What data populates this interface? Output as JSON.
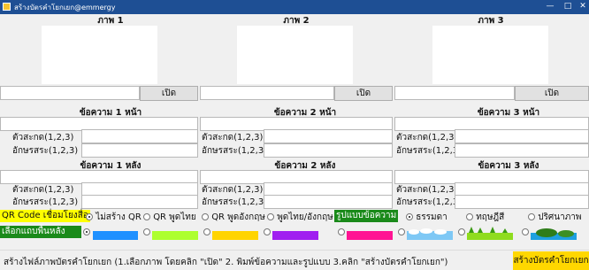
{
  "window": {
    "title": "สร้างบัตรคำโยกเยก@emmergy"
  },
  "panels": [
    {
      "image_label": "ภาพ 1",
      "open_label": "เปิด",
      "front_header": "ข้อความ 1 หน้า",
      "back_header": "ข้อความ 1 หลัง"
    },
    {
      "image_label": "ภาพ 2",
      "open_label": "เปิด",
      "front_header": "ข้อความ 2 หน้า",
      "back_header": "ข้อความ 2 หลัง"
    },
    {
      "image_label": "ภาพ 3",
      "open_label": "เปิด",
      "front_header": "ข้อความ 3 หน้า",
      "back_header": "ข้อความ 3 หลัง"
    }
  ],
  "labels": {
    "vowel": "ตัวสะกด(1,2,3)",
    "letters": "อักษรสระ(1,2,3)"
  },
  "qr": {
    "label": "QR Code เชื่อมโยงสื่อ",
    "options": [
      "ไม่สร้าง QR",
      "QR พูดไทย",
      "QR พูดอังกฤษ",
      "พูดไทย/อังกฤษ"
    ],
    "selected": 0
  },
  "style": {
    "label": "รูปแบบข้อความ",
    "options": [
      "ธรรมดา",
      "ทฤษฎีสี",
      "ปริศนาภาพ"
    ],
    "selected": 0
  },
  "background": {
    "label": "เลือกแถบพื้นหลัง",
    "swatches": [
      {
        "name": "blue",
        "color": "#1e90ff"
      },
      {
        "name": "lime",
        "color": "#adff2f"
      },
      {
        "name": "gold",
        "color": "#ffd400"
      },
      {
        "name": "purple",
        "color": "#a020f0"
      },
      {
        "name": "pink",
        "color": "#ff1493"
      },
      {
        "name": "sky-clouds",
        "color": "#7ec8f5"
      },
      {
        "name": "grass",
        "color": "#8fdc1e"
      },
      {
        "name": "sea-island",
        "color": "#1ea0e0"
      }
    ],
    "selected": 0
  },
  "status": {
    "instructions": "สร้างไฟล์ภาพบัตรคำโยกเยก (1.เลือกภาพ โดยคลิก \"เปิด\" 2. พิมพ์ข้อความและรูปแบบ 3.คลิก \"สร้างบัตรคำโยกเยก\")",
    "create_button": "สร้างบัตรคำโยกเยก"
  },
  "colors": {
    "titlebar": "#1e4f94",
    "qr_label_bg": "#ffff00",
    "style_label_bg": "#1a8a1a",
    "bg_label_bg": "#1a8a1a",
    "create_bg": "#ffd700"
  }
}
